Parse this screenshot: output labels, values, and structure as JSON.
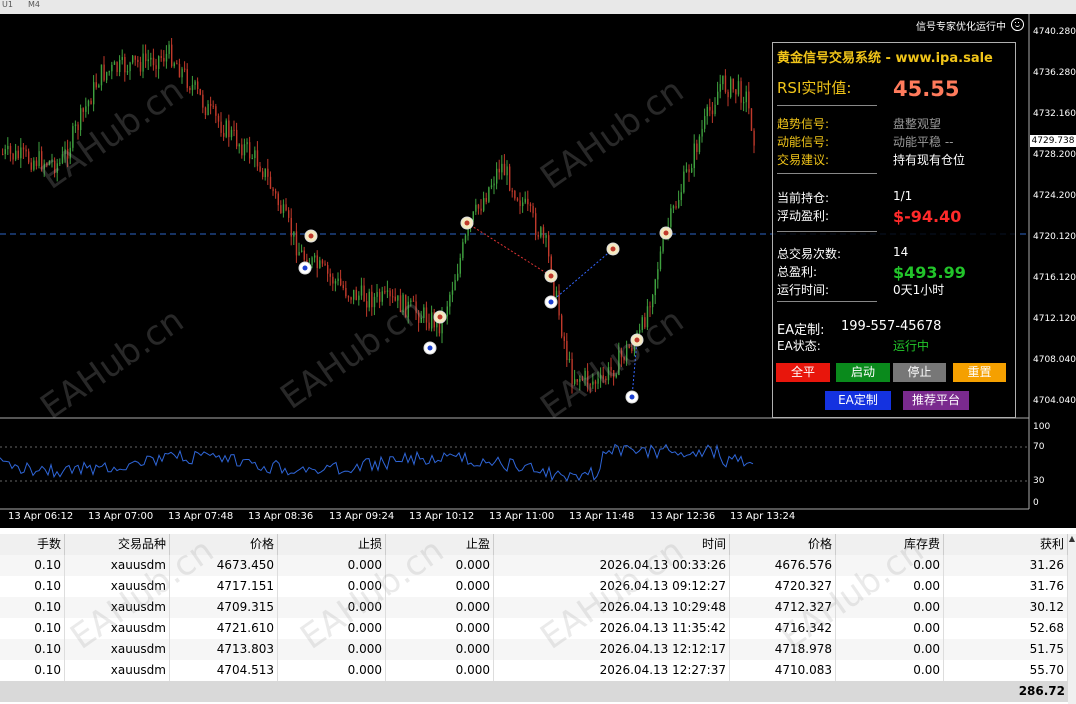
{
  "window": {
    "top_tabs": [
      "U1",
      "M4"
    ]
  },
  "chart": {
    "status_text": "信号专家优化运行中",
    "current_price": "4729.738",
    "price_labels": [
      "4740.280",
      "4736.280",
      "4732.160",
      "4728.200",
      "4724.200",
      "4720.120",
      "4716.120",
      "4712.120",
      "4708.040",
      "4704.040"
    ],
    "rsi_labels": [
      "100",
      "70",
      "30",
      "0"
    ],
    "time_labels": [
      "13 Apr 06:12",
      "13 Apr 07:00",
      "13 Apr 07:48",
      "13 Apr 08:36",
      "13 Apr 09:24",
      "13 Apr 10:12",
      "13 Apr 11:00",
      "13 Apr 11:48",
      "13 Apr 12:36",
      "13 Apr 13:24"
    ],
    "watermark": "EAHub.cn",
    "colors": {
      "bull": "#3fa13f",
      "bear": "#c0392b",
      "level": "#2b63c4",
      "rsi": "#2f66d8"
    }
  },
  "panel": {
    "title_cn": "黄金信号交易系统",
    "title_sep": " - ",
    "title_url": "www.ipa.sale",
    "rsi_label": "RSI实时值:",
    "rsi_value": "45.55",
    "trend_label": "趋势信号:",
    "trend_value": "盘整观望",
    "momentum_label": "动能信号:",
    "momentum_value": "动能平稳 --",
    "advice_label": "交易建议:",
    "advice_value": "持有现有仓位",
    "position_label": "当前持仓:",
    "position_value": "1/1",
    "float_label": "浮动盈利:",
    "float_value": "$-94.40",
    "trades_label": "总交易次数:",
    "trades_value": "14",
    "profit_label": "总盈利:",
    "profit_value": "$493.99",
    "runtime_label": "运行时间:",
    "runtime_value": "0天1小时",
    "custom_label": "EA定制:",
    "custom_value": "199-557-45678",
    "state_label": "EA状态:",
    "state_value": "运行中",
    "buttons": {
      "close_all": "全平",
      "start": "启动",
      "stop": "停止",
      "reset": "重置",
      "ea_custom": "EA定制",
      "recommend": "推荐平台"
    },
    "button_colors": {
      "close_all": "#e8160c",
      "start": "#0a8a1c",
      "stop": "#777777",
      "reset": "#f5a000",
      "ea_custom": "#1432e0",
      "recommend": "#7a2a8e"
    }
  },
  "trades": {
    "headers": [
      "手数",
      "交易品种",
      "价格",
      "止损",
      "止盈",
      "时间",
      "价格",
      "库存费",
      "获利"
    ],
    "rows": [
      [
        "0.10",
        "xauusdm",
        "4673.450",
        "0.000",
        "0.000",
        "2026.04.13 00:33:26",
        "4676.576",
        "0.00",
        "31.26"
      ],
      [
        "0.10",
        "xauusdm",
        "4717.151",
        "0.000",
        "0.000",
        "2026.04.13 09:12:27",
        "4720.327",
        "0.00",
        "31.76"
      ],
      [
        "0.10",
        "xauusdm",
        "4709.315",
        "0.000",
        "0.000",
        "2026.04.13 10:29:48",
        "4712.327",
        "0.00",
        "30.12"
      ],
      [
        "0.10",
        "xauusdm",
        "4721.610",
        "0.000",
        "0.000",
        "2026.04.13 11:35:42",
        "4716.342",
        "0.00",
        "52.68"
      ],
      [
        "0.10",
        "xauusdm",
        "4713.803",
        "0.000",
        "0.000",
        "2026.04.13 12:12:17",
        "4718.978",
        "0.00",
        "51.75"
      ],
      [
        "0.10",
        "xauusdm",
        "4704.513",
        "0.000",
        "0.000",
        "2026.04.13 12:27:37",
        "4710.083",
        "0.00",
        "55.70"
      ]
    ],
    "total": "286.72"
  }
}
